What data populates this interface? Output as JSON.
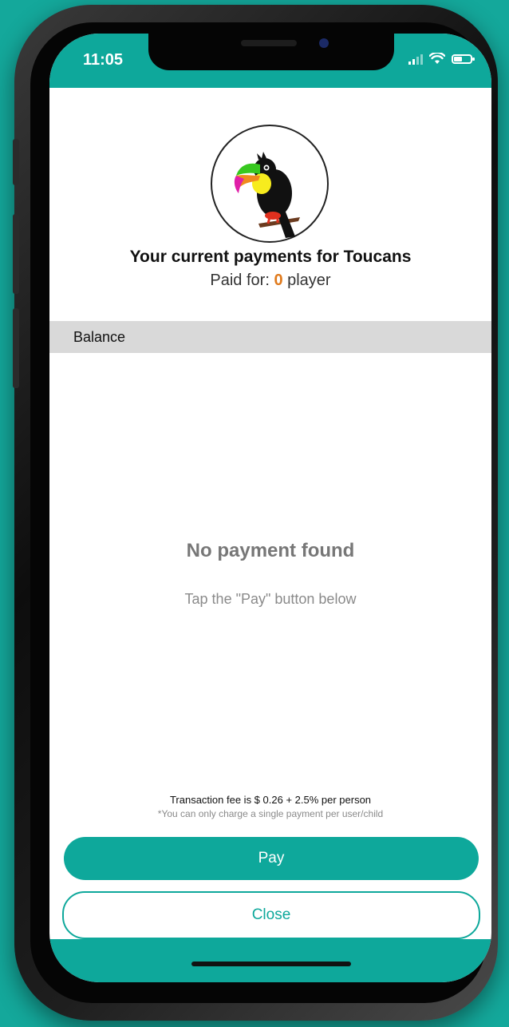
{
  "status_bar": {
    "time": "11:05",
    "battery_level": 0.45,
    "icons": [
      "signal-icon",
      "wifi-icon",
      "battery-icon"
    ]
  },
  "header": {
    "logo_icon": "toucan-logo",
    "title": "Your current payments for Toucans",
    "paid_for_prefix": "Paid for: ",
    "paid_for_count": "0",
    "paid_for_suffix": " player"
  },
  "balance": {
    "label": "Balance"
  },
  "empty_state": {
    "title": "No payment found",
    "hint": "Tap the \"Pay\" button below"
  },
  "footer": {
    "fee_text": "Transaction fee is $ 0.26 + 2.5% per person",
    "fee_note": "*You can only charge a single payment per user/child"
  },
  "actions": {
    "pay_label": "Pay",
    "close_label": "Close"
  },
  "colors": {
    "accent": "#0ea89b",
    "background": "#14a89b",
    "count": "#e07a1c"
  }
}
